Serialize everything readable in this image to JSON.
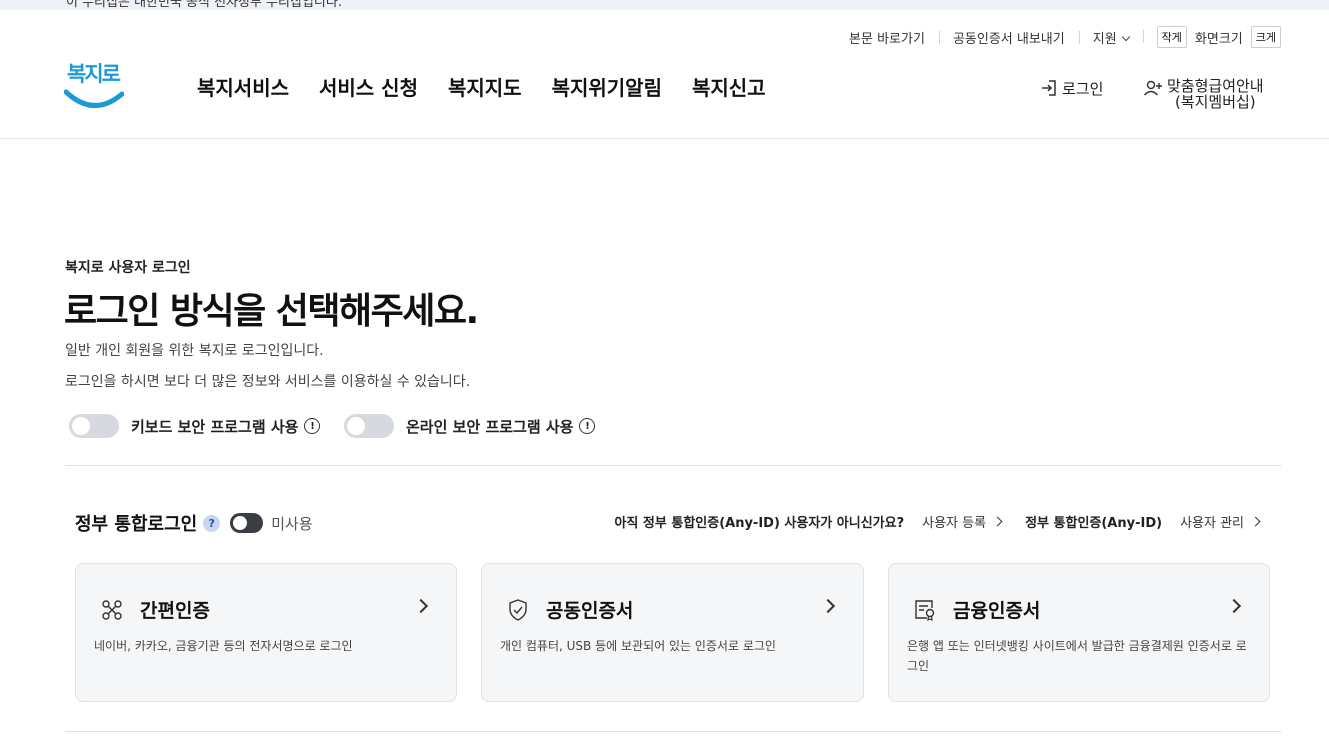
{
  "banner": {
    "text": "이 누리집은 대한민국 공식 전자정부 누리집입니다."
  },
  "utility": {
    "skip_link": "본문 바로가기",
    "cert_export": "공동인증서 내보내기",
    "support": "지원",
    "font_small": "작게",
    "font_label": "화면크기",
    "font_large": "크게"
  },
  "logo": {
    "text": "복지로"
  },
  "nav": {
    "items": [
      "복지서비스",
      "서비스 신청",
      "복지지도",
      "복지위기알림",
      "복지신고"
    ]
  },
  "header_right": {
    "login": "로그인",
    "custom_line1": "맞춤형급여안내",
    "custom_line2": "(복지멤버십)"
  },
  "main": {
    "eyebrow": "복지로 사용자 로그인",
    "title": "로그인 방식을 선택해주세요.",
    "desc1": "일반 개인 회원을 위한 복지로 로그인입니다.",
    "desc2": "로그인을 하시면 보다 더 많은 정보와 서비스를 이용하실 수 있습니다.",
    "keyboard_security": "키보드 보안 프로그램 사용",
    "online_security": "온라인 보안 프로그램 사용",
    "info_mark": "!"
  },
  "gov_login": {
    "title": "정부 통합로그인",
    "help_mark": "?",
    "state": "미사용",
    "anyid_question": "아직 정부 통합인증(Any-ID) 사용자가 아니신가요?",
    "register": "사용자 등록",
    "anyid_label": "정부 통합인증(Any-ID)",
    "manage": "사용자 관리"
  },
  "cards": [
    {
      "icon": "simple-auth-icon",
      "title": "간편인증",
      "desc": "네이버, 카카오, 금융기관 등의 전자서명으로 로그인"
    },
    {
      "icon": "shield-check-icon",
      "title": "공동인증서",
      "desc": "개인 컴퓨터, USB 등에 보관되어 있는 인증서로 로그인"
    },
    {
      "icon": "financial-cert-icon",
      "title": "금융인증서",
      "desc": "은행 앱 또는 인터넷뱅킹 사이트에서 발급한 금융결제원 인증서로 로그인"
    }
  ],
  "colors": {
    "brand": "#1a9ad6",
    "toggle_off": "#d6d9de",
    "toggle_dark": "#3a3d42",
    "card_bg": "#f5f6f7"
  }
}
